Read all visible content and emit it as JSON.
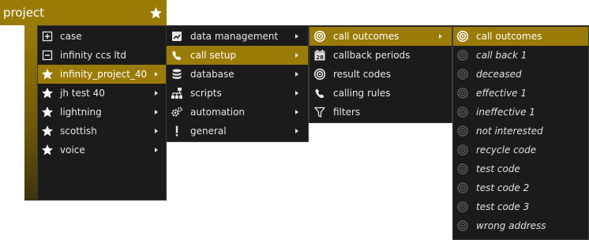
{
  "header": {
    "title": "project",
    "star_icon": "star-icon"
  },
  "colors": {
    "accent": "#9b7b07",
    "menu_bg": "#1b1b1b",
    "text": "#e6e6e6"
  },
  "menu1": {
    "items": [
      {
        "label": "case",
        "icon": "plus-box-icon",
        "has_submenu": false
      },
      {
        "label": "infinity ccs ltd",
        "icon": "minus-box-icon",
        "has_submenu": false
      },
      {
        "label": "infinity_project_40",
        "icon": "star-icon",
        "has_submenu": true,
        "active": true
      },
      {
        "label": "jh test 40",
        "icon": "star-icon",
        "has_submenu": true
      },
      {
        "label": "lightning",
        "icon": "star-icon",
        "has_submenu": true
      },
      {
        "label": "scottish",
        "icon": "star-icon",
        "has_submenu": true
      },
      {
        "label": "voice",
        "icon": "star-icon",
        "has_submenu": true
      }
    ]
  },
  "menu2": {
    "items": [
      {
        "label": "data management",
        "icon": "chart-icon",
        "has_submenu": true
      },
      {
        "label": "call setup",
        "icon": "phone-icon",
        "has_submenu": true,
        "active": true
      },
      {
        "label": "database",
        "icon": "database-icon",
        "has_submenu": true
      },
      {
        "label": "scripts",
        "icon": "sitemap-icon",
        "has_submenu": true
      },
      {
        "label": "automation",
        "icon": "cogs-icon",
        "has_submenu": true
      },
      {
        "label": "general",
        "icon": "exclamation-icon",
        "has_submenu": true
      }
    ]
  },
  "menu3": {
    "items": [
      {
        "label": "call outcomes",
        "icon": "target-icon",
        "has_submenu": true,
        "active": true
      },
      {
        "label": "callback periods",
        "icon": "calendar-icon",
        "calendar_day": "28",
        "has_submenu": false
      },
      {
        "label": "result codes",
        "icon": "target-icon",
        "has_submenu": false
      },
      {
        "label": "calling rules",
        "icon": "phone-icon",
        "has_submenu": false
      },
      {
        "label": "filters",
        "icon": "filter-icon",
        "has_submenu": false
      }
    ]
  },
  "menu4": {
    "items": [
      {
        "label": "call outcomes",
        "icon": "target-icon",
        "active": true
      },
      {
        "label": "call back 1",
        "icon": "target-icon"
      },
      {
        "label": "deceased",
        "icon": "target-icon"
      },
      {
        "label": "effective 1",
        "icon": "target-icon"
      },
      {
        "label": "ineffective 1",
        "icon": "target-icon"
      },
      {
        "label": "not interested",
        "icon": "target-icon"
      },
      {
        "label": "recycle code",
        "icon": "target-icon"
      },
      {
        "label": "test code",
        "icon": "target-icon"
      },
      {
        "label": "test code 2",
        "icon": "target-icon"
      },
      {
        "label": "test code 3",
        "icon": "target-icon"
      },
      {
        "label": "wrong address",
        "icon": "target-icon"
      }
    ]
  }
}
